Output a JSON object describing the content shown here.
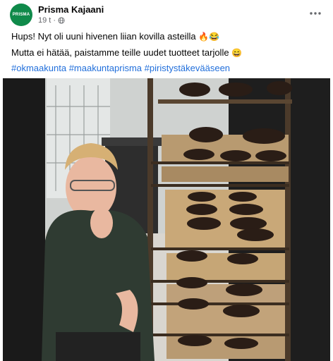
{
  "post": {
    "page_name": "Prisma Kajaani",
    "avatar_text": "PRISMA",
    "timestamp": "19 t",
    "separator": "·",
    "line1_text": "Hups! Nyt oli uuni hivenen liian kovilla asteilla",
    "line1_emojis": "🔥😂",
    "line2_text": "Mutta ei hätää, paistamme teille uudet tuotteet tarjolle",
    "line2_emoji": "😄",
    "hashtags": [
      "#okmaakunta",
      "#maakuntaprisma",
      "#piristystäkevääseen"
    ]
  },
  "colors": {
    "brand": "#0f8a4a",
    "link": "#216fdb",
    "meta": "#65676b"
  },
  "icons": {
    "more": "more-options-icon",
    "audience": "globe-icon"
  }
}
